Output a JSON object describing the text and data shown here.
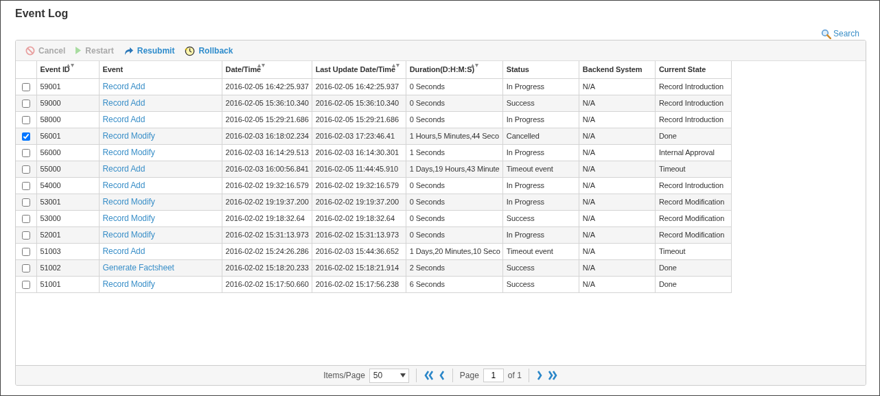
{
  "title": "Event Log",
  "search": {
    "label": "Search"
  },
  "toolbar": [
    {
      "label": "Cancel",
      "kind": "cancel",
      "disabled": true
    },
    {
      "label": "Restart",
      "kind": "restart",
      "disabled": true
    },
    {
      "label": "Resubmit",
      "kind": "resubmit",
      "disabled": false
    },
    {
      "label": "Rollback",
      "kind": "rollback",
      "disabled": false
    }
  ],
  "table": {
    "columns": [
      {
        "label": "Event ID",
        "sortable": true,
        "kind": "text"
      },
      {
        "label": "Event",
        "sortable": false,
        "kind": "link"
      },
      {
        "label": "Date/Time",
        "sortable": true,
        "kind": "text"
      },
      {
        "label": "Last Update Date/Time",
        "sortable": true,
        "kind": "text"
      },
      {
        "label": "Duration(D:H:M:S)",
        "sortable": true,
        "kind": "text"
      },
      {
        "label": "Status",
        "sortable": false,
        "kind": "text"
      },
      {
        "label": "Backend System",
        "sortable": false,
        "kind": "text"
      },
      {
        "label": "Current State",
        "sortable": false,
        "kind": "text"
      }
    ],
    "rows": [
      {
        "checked": false,
        "cells": [
          "59001",
          "Record Add",
          "2016-02-05 16:42:25.937",
          "2016-02-05 16:42:25.937",
          "0 Seconds",
          "In Progress",
          "N/A",
          "Record Introduction"
        ]
      },
      {
        "checked": false,
        "cells": [
          "59000",
          "Record Add",
          "2016-02-05 15:36:10.340",
          "2016-02-05 15:36:10.340",
          "0 Seconds",
          "Success",
          "N/A",
          "Record Introduction"
        ]
      },
      {
        "checked": false,
        "cells": [
          "58000",
          "Record Add",
          "2016-02-05 15:29:21.686",
          "2016-02-05 15:29:21.686",
          "0 Seconds",
          "In Progress",
          "N/A",
          "Record Introduction"
        ]
      },
      {
        "checked": true,
        "cells": [
          "56001",
          "Record Modify",
          "2016-02-03 16:18:02.234",
          "2016-02-03 17:23:46.41",
          "1 Hours,5 Minutes,44 Seco",
          "Cancelled",
          "N/A",
          "Done"
        ]
      },
      {
        "checked": false,
        "cells": [
          "56000",
          "Record Modify",
          "2016-02-03 16:14:29.513",
          "2016-02-03 16:14:30.301",
          "1 Seconds",
          "In Progress",
          "N/A",
          "Internal Approval"
        ]
      },
      {
        "checked": false,
        "cells": [
          "55000",
          "Record Add",
          "2016-02-03 16:00:56.841",
          "2016-02-05 11:44:45.910",
          "1 Days,19 Hours,43 Minute",
          "Timeout event",
          "N/A",
          "Timeout"
        ]
      },
      {
        "checked": false,
        "cells": [
          "54000",
          "Record Add",
          "2016-02-02 19:32:16.579",
          "2016-02-02 19:32:16.579",
          "0 Seconds",
          "In Progress",
          "N/A",
          "Record Introduction"
        ]
      },
      {
        "checked": false,
        "cells": [
          "53001",
          "Record Modify",
          "2016-02-02 19:19:37.200",
          "2016-02-02 19:19:37.200",
          "0 Seconds",
          "In Progress",
          "N/A",
          "Record Modification"
        ]
      },
      {
        "checked": false,
        "cells": [
          "53000",
          "Record Modify",
          "2016-02-02 19:18:32.64",
          "2016-02-02 19:18:32.64",
          "0 Seconds",
          "Success",
          "N/A",
          "Record Modification"
        ]
      },
      {
        "checked": false,
        "cells": [
          "52001",
          "Record Modify",
          "2016-02-02 15:31:13.973",
          "2016-02-02 15:31:13.973",
          "0 Seconds",
          "In Progress",
          "N/A",
          "Record Modification"
        ]
      },
      {
        "checked": false,
        "cells": [
          "51003",
          "Record Add",
          "2016-02-02 15:24:26.286",
          "2016-02-03 15:44:36.652",
          "1 Days,20 Minutes,10 Seco",
          "Timeout event",
          "N/A",
          "Timeout"
        ]
      },
      {
        "checked": false,
        "cells": [
          "51002",
          "Generate Factsheet",
          "2016-02-02 15:18:20.233",
          "2016-02-02 15:18:21.914",
          "2 Seconds",
          "Success",
          "N/A",
          "Done"
        ]
      },
      {
        "checked": false,
        "cells": [
          "51001",
          "Record Modify",
          "2016-02-02 15:17:50.660",
          "2016-02-02 15:17:56.238",
          "6 Seconds",
          "Success",
          "N/A",
          "Done"
        ]
      }
    ]
  },
  "pagination": {
    "items_label": "Items/Page",
    "items_per_page": "50",
    "page_label": "Page",
    "page": "1",
    "of_label": "of 1"
  }
}
